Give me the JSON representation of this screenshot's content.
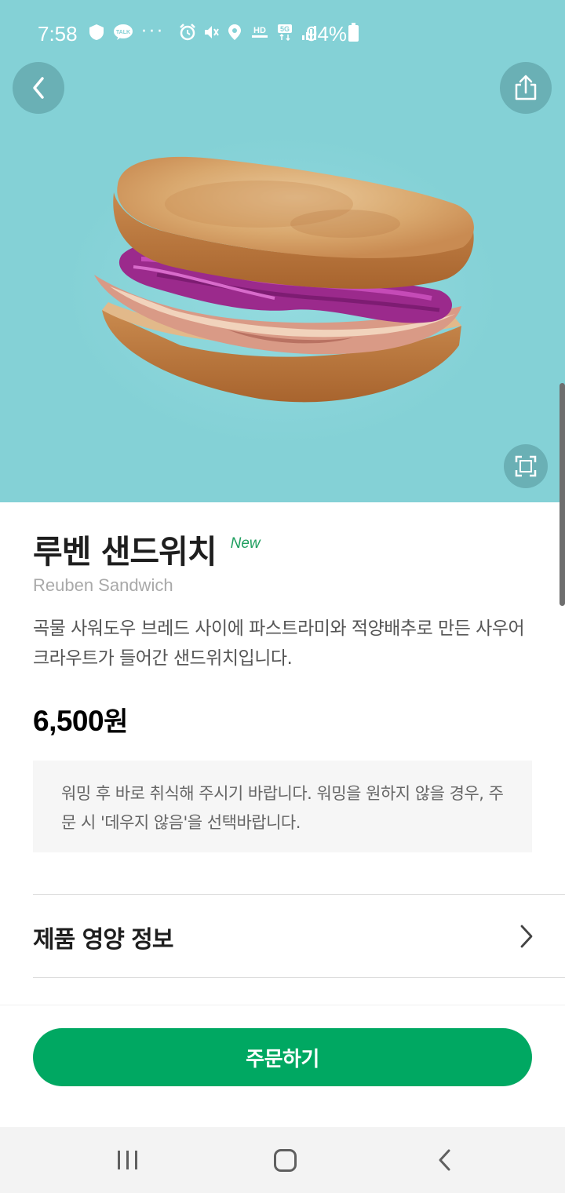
{
  "status_bar": {
    "time": "7:58",
    "battery": "94%",
    "icons": [
      "shield-icon",
      "kakaotalk-icon",
      "more-dots-icon",
      "alarm-icon",
      "mute-icon",
      "location-icon",
      "hd-voice-icon",
      "5g-icon",
      "signal-icon",
      "battery-icon"
    ],
    "talk_label": "TALK",
    "hd_label": "HD",
    "fiveg_label": "5G"
  },
  "hero": {
    "background_color": "#84d1d6",
    "image": "reuben-sandwich-photo",
    "back_icon": "chevron-left-icon",
    "share_icon": "share-icon",
    "expand_icon": "expand-icon"
  },
  "product": {
    "name_ko": "루벤 샌드위치",
    "badge": "New",
    "name_en": "Reuben Sandwich",
    "description": "곡물 사워도우 브레드 사이에 파스트라미와 적양배추로 만든 사우어 크라우트가 들어간 샌드위치입니다.",
    "price": "6,500",
    "currency": "원",
    "notice": "워밍 후 바로 취식해 주시기 바랍니다. 워밍을 원하지 않을 경우, 주문 시 '데우지 않음'을 선택바랍니다."
  },
  "nutrition": {
    "label": "제품 영양 정보",
    "icon": "chevron-right-icon"
  },
  "order": {
    "button_label": "주문하기",
    "button_color": "#00a862"
  },
  "nav": {
    "icons": [
      "recent-apps-icon",
      "home-icon",
      "back-icon"
    ]
  }
}
